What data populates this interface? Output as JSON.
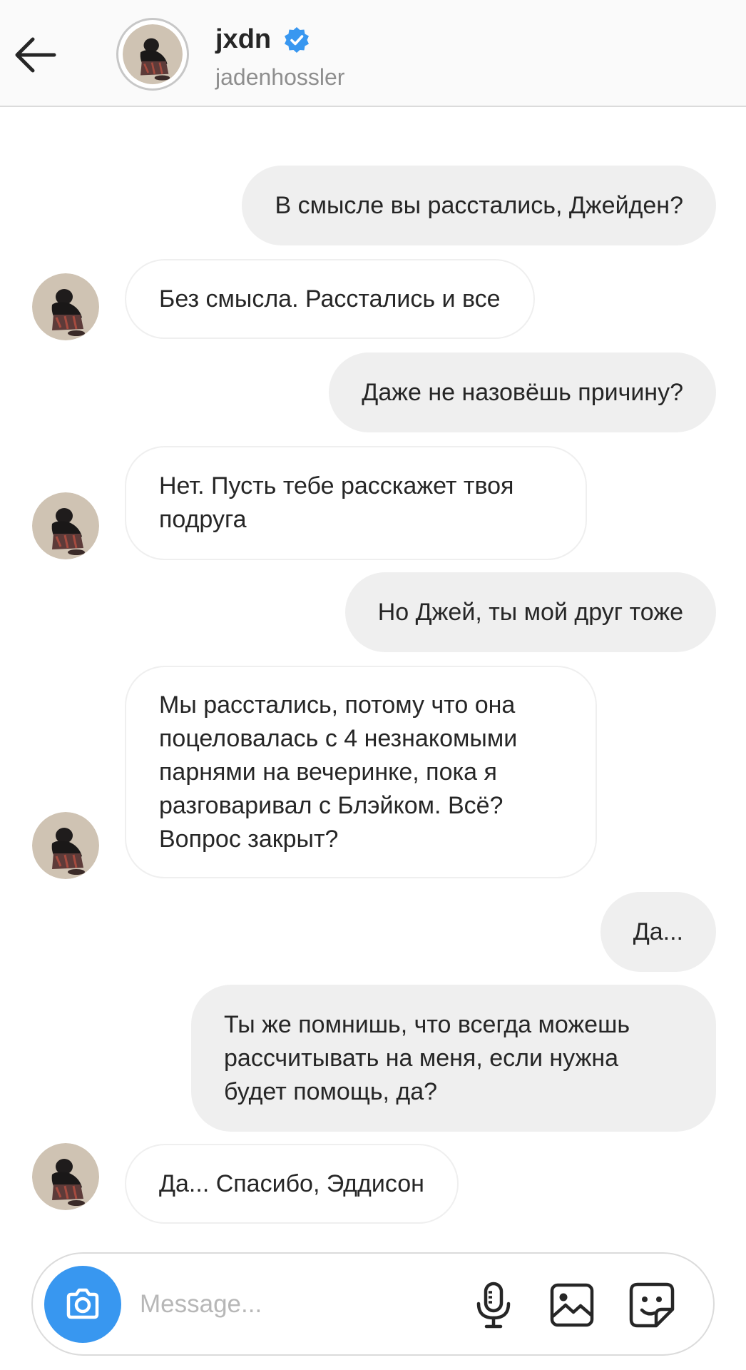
{
  "header": {
    "name": "jxdn",
    "username": "jadenhossler",
    "verified": true
  },
  "messages": [
    {
      "side": "sent",
      "text": "В смысле вы расстались, Джейден?"
    },
    {
      "side": "recv",
      "text": "Без смысла. Расстались и все"
    },
    {
      "side": "sent",
      "text": "Даже не назовёшь причину?"
    },
    {
      "side": "recv",
      "text": "Нет. Пусть тебе расскажет твоя\nподруга"
    },
    {
      "side": "sent",
      "text": "Но Джей, ты мой друг тоже"
    },
    {
      "side": "recv",
      "text": "Мы расстались, потому что она\nпоцеловалась с 4 незнакомыми\nпарнями на вечеринке, пока я\nразговаривал с Блэйком. Всё?\nВопрос закрыт?"
    },
    {
      "side": "sent",
      "text": "Да..."
    },
    {
      "side": "sent",
      "text": "Ты же помнишь, что всегда можешь\nрассчитывать на меня, если нужна\nбудет помощь, да?"
    },
    {
      "side": "recv",
      "text": "Да... Спасибо, Эддисон"
    }
  ],
  "composer": {
    "placeholder": "Message..."
  },
  "icons": {
    "back": "arrow-left-icon",
    "verified": "verified-badge-icon",
    "camera": "camera-icon",
    "mic": "microphone-icon",
    "gallery": "image-icon",
    "sticker": "sticker-icon"
  },
  "colors": {
    "accent": "#3897f0",
    "sent_bubble": "#efefef",
    "received_border": "#efefef",
    "muted_text": "#8e8e8e"
  }
}
